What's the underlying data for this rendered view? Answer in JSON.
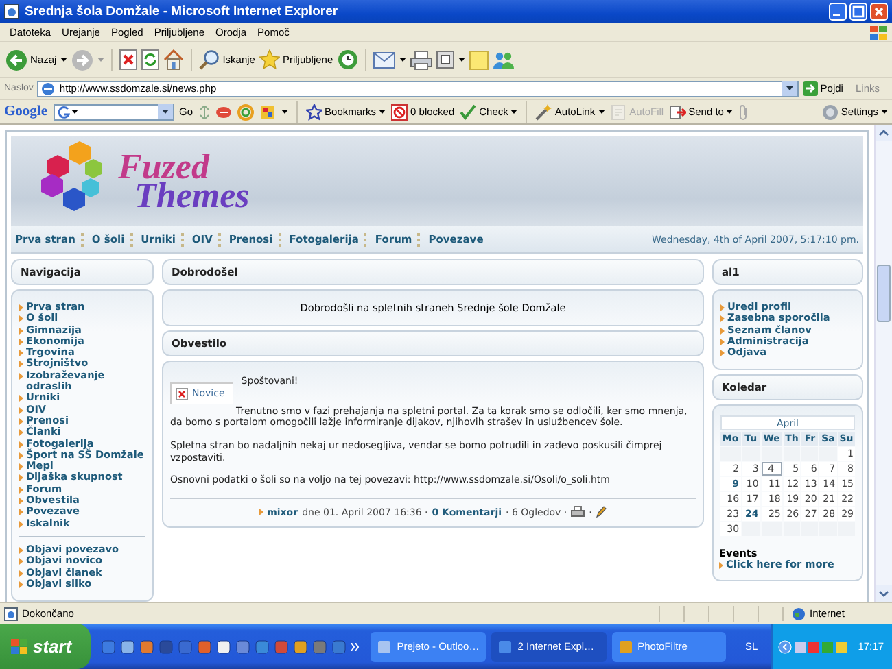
{
  "window": {
    "title": "Srednja šola Domžale - Microsoft Internet Explorer"
  },
  "menu": [
    "Datoteka",
    "Urejanje",
    "Pogled",
    "Priljubljene",
    "Orodja",
    "Pomoč"
  ],
  "toolbar": {
    "back": "Nazaj",
    "search": "Iskanje",
    "favorites": "Priljubljene"
  },
  "address": {
    "label": "Naslov",
    "value": "http://www.ssdomzale.si/news.php",
    "go": "Pojdi",
    "links": "Links"
  },
  "google_toolbar": {
    "logo": "Google",
    "go": "Go",
    "items": [
      {
        "label": "Bookmarks",
        "dropdown": true,
        "disabled": false
      },
      {
        "label": "0 blocked",
        "dropdown": false,
        "disabled": false
      },
      {
        "label": "Check",
        "dropdown": true,
        "disabled": false
      },
      {
        "label": "AutoLink",
        "dropdown": true,
        "disabled": false
      },
      {
        "label": "AutoFill",
        "dropdown": false,
        "disabled": true
      },
      {
        "label": "Send to",
        "dropdown": true,
        "disabled": false
      },
      {
        "label": "Settings",
        "dropdown": true,
        "disabled": false
      }
    ]
  },
  "site": {
    "logo": [
      "Fuzed",
      "Themes"
    ],
    "nav": [
      "Prva stran",
      "O šoli",
      "Urniki",
      "OIV",
      "Prenosi",
      "Fotogalerija",
      "Forum",
      "Povezave"
    ],
    "date": "Wednesday, 4th of April 2007, 5:17:10 pm."
  },
  "left": {
    "title": "Navigacija",
    "groups": [
      [
        "Prva stran",
        "O šoli",
        "Gimnazija",
        "Ekonomija",
        "Trgovina",
        "Strojništvo",
        "Izobraževanje odraslih",
        "Urniki",
        "OIV",
        "Prenosi",
        "Članki",
        "Fotogalerija",
        "Šport na SŠ Domžale",
        "Mepi",
        "Dijaška skupnost",
        "Forum",
        "Obvestila",
        "Povezave",
        "Iskalnik"
      ],
      [
        "Objavi povezavo",
        "Objavi novico",
        "Objavi članek",
        "Objavi sliko"
      ]
    ]
  },
  "center": {
    "welcome_title": "Dobrodošel",
    "welcome_text": "Dobrodošli na spletnih straneh Srednje šole Domžale",
    "news_title": "Obvestilo",
    "article": {
      "image_label": "Novice",
      "greeting": "Spoštovani!",
      "paragraphs": [
        "Trenutno smo v fazi prehajanja na spletni portal. Za ta korak smo se odločili, ker smo mnenja, da bomo s portalom omogočili lažje informiranje dijakov, njihovih strašev in uslužbencev šole.",
        "Spletna stran bo nadaljnih nekaj ur nedosegljiva, vendar se bomo potrudili in zadevo poskusili čimprej vzpostaviti.",
        "Osnovni podatki o šoli so na voljo na tej povezavi: http://www.ssdomzale.si/Osoli/o_soli.htm"
      ],
      "author": "mixor",
      "posted": "dne 01. April 2007 16:36 ·",
      "comments": "0 Komentarji",
      "views": "· 6 Ogledov ·",
      "separator": "·"
    }
  },
  "right": {
    "user_title": "al1",
    "user_links": [
      "Uredi profil",
      "Zasebna sporočila",
      "Seznam članov",
      "Administracija",
      "Odjava"
    ],
    "calendar": {
      "title": "Koledar",
      "month": "April",
      "weekdays": [
        "Mo",
        "Tu",
        "We",
        "Th",
        "Fr",
        "Sa",
        "Su"
      ],
      "weeks": [
        [
          {
            "day": "1",
            "today": false,
            "event": false
          }
        ],
        [
          {
            "day": "2",
            "today": false,
            "event": false
          },
          {
            "day": "3",
            "today": false,
            "event": false
          },
          {
            "day": "4",
            "today": true,
            "event": false
          },
          {
            "day": "5",
            "today": false,
            "event": false
          },
          {
            "day": "6",
            "today": false,
            "event": false
          },
          {
            "day": "7",
            "today": false,
            "event": false
          },
          {
            "day": "8",
            "today": false,
            "event": false
          }
        ],
        [
          {
            "day": "9",
            "today": false,
            "event": true
          },
          {
            "day": "10",
            "today": false,
            "event": false
          },
          {
            "day": "11",
            "today": false,
            "event": false
          },
          {
            "day": "12",
            "today": false,
            "event": false
          },
          {
            "day": "13",
            "today": false,
            "event": false
          },
          {
            "day": "14",
            "today": false,
            "event": false
          },
          {
            "day": "15",
            "today": false,
            "event": false
          }
        ],
        [
          {
            "day": "16",
            "today": false,
            "event": false
          },
          {
            "day": "17",
            "today": false,
            "event": false
          },
          {
            "day": "18",
            "today": false,
            "event": false
          },
          {
            "day": "19",
            "today": false,
            "event": false
          },
          {
            "day": "20",
            "today": false,
            "event": false
          },
          {
            "day": "21",
            "today": false,
            "event": false
          },
          {
            "day": "22",
            "today": false,
            "event": false
          }
        ],
        [
          {
            "day": "23",
            "today": false,
            "event": false
          },
          {
            "day": "24",
            "today": false,
            "event": true
          },
          {
            "day": "25",
            "today": false,
            "event": false
          },
          {
            "day": "26",
            "today": false,
            "event": false
          },
          {
            "day": "27",
            "today": false,
            "event": false
          },
          {
            "day": "28",
            "today": false,
            "event": false
          },
          {
            "day": "29",
            "today": false,
            "event": false
          }
        ],
        [
          {
            "day": "30",
            "today": false,
            "event": false
          }
        ]
      ],
      "events_label": "Events",
      "events_link": "Click here for more"
    }
  },
  "status_bar": {
    "text": "Dokončano",
    "zone": "Internet"
  },
  "taskbar": {
    "start": "start",
    "tasks": [
      {
        "label": "Prejeto - Outloo…",
        "selected": false
      },
      {
        "label": "2 Internet Expl…",
        "selected": true
      },
      {
        "label": "PhotoFiltre",
        "selected": false
      }
    ],
    "language": "SL",
    "clock": "17:17"
  }
}
